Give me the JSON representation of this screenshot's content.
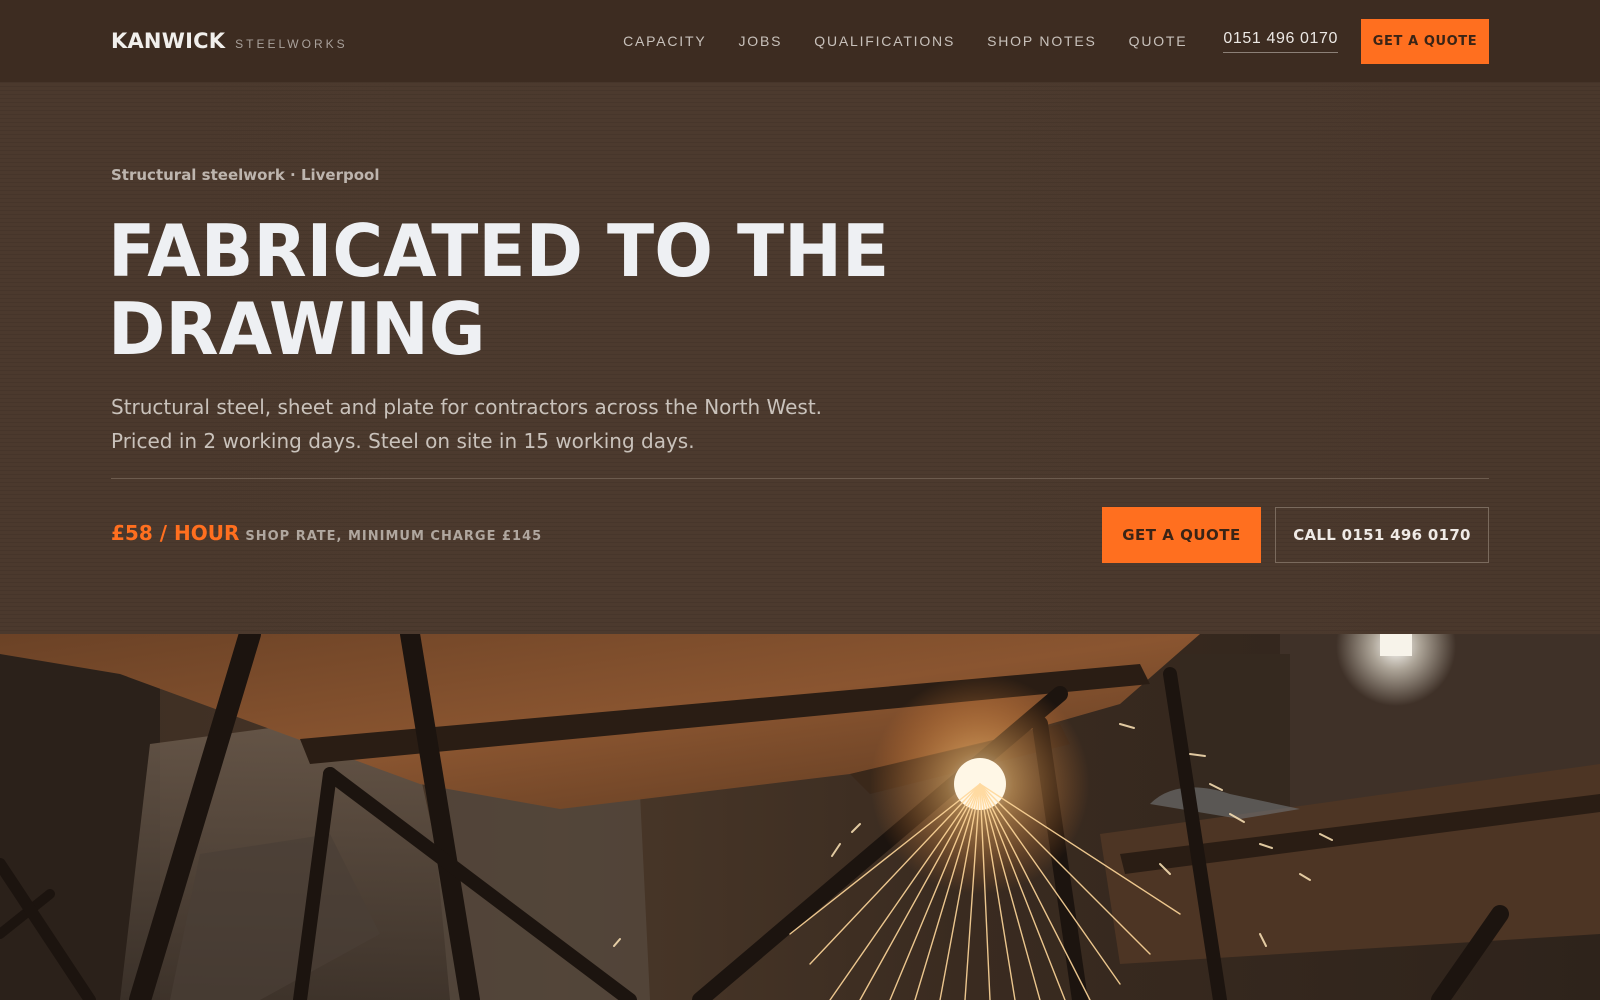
{
  "header": {
    "brand": "KANWICK",
    "brand_sub": "STEELWORKS",
    "nav": [
      "CAPACITY",
      "JOBS",
      "QUALIFICATIONS",
      "SHOP NOTES",
      "QUOTE"
    ],
    "phone": "0151 496 0170",
    "cta": "GET A QUOTE"
  },
  "hero": {
    "eyebrow": "Structural steelwork · Liverpool",
    "headline_line1": "FABRICATED TO THE",
    "headline_line2": "DRAWING",
    "lede": "Structural steel, sheet and plate for contractors across the North West. Priced in 2 working days. Steel on site in 15 working days.",
    "rate_price": "£58 / HOUR",
    "rate_note": "SHOP RATE, MINIMUM CHARGE £145",
    "primary_cta": "GET A QUOTE",
    "secondary_cta": "CALL 0151 496 0170"
  },
  "photo": {
    "icon": "welding-sparks-photo"
  },
  "colors": {
    "accent": "#ff6f1f",
    "header_bg": "#3d2c21",
    "hero_bg": "#4a382c",
    "headline": "#eef0f3"
  }
}
